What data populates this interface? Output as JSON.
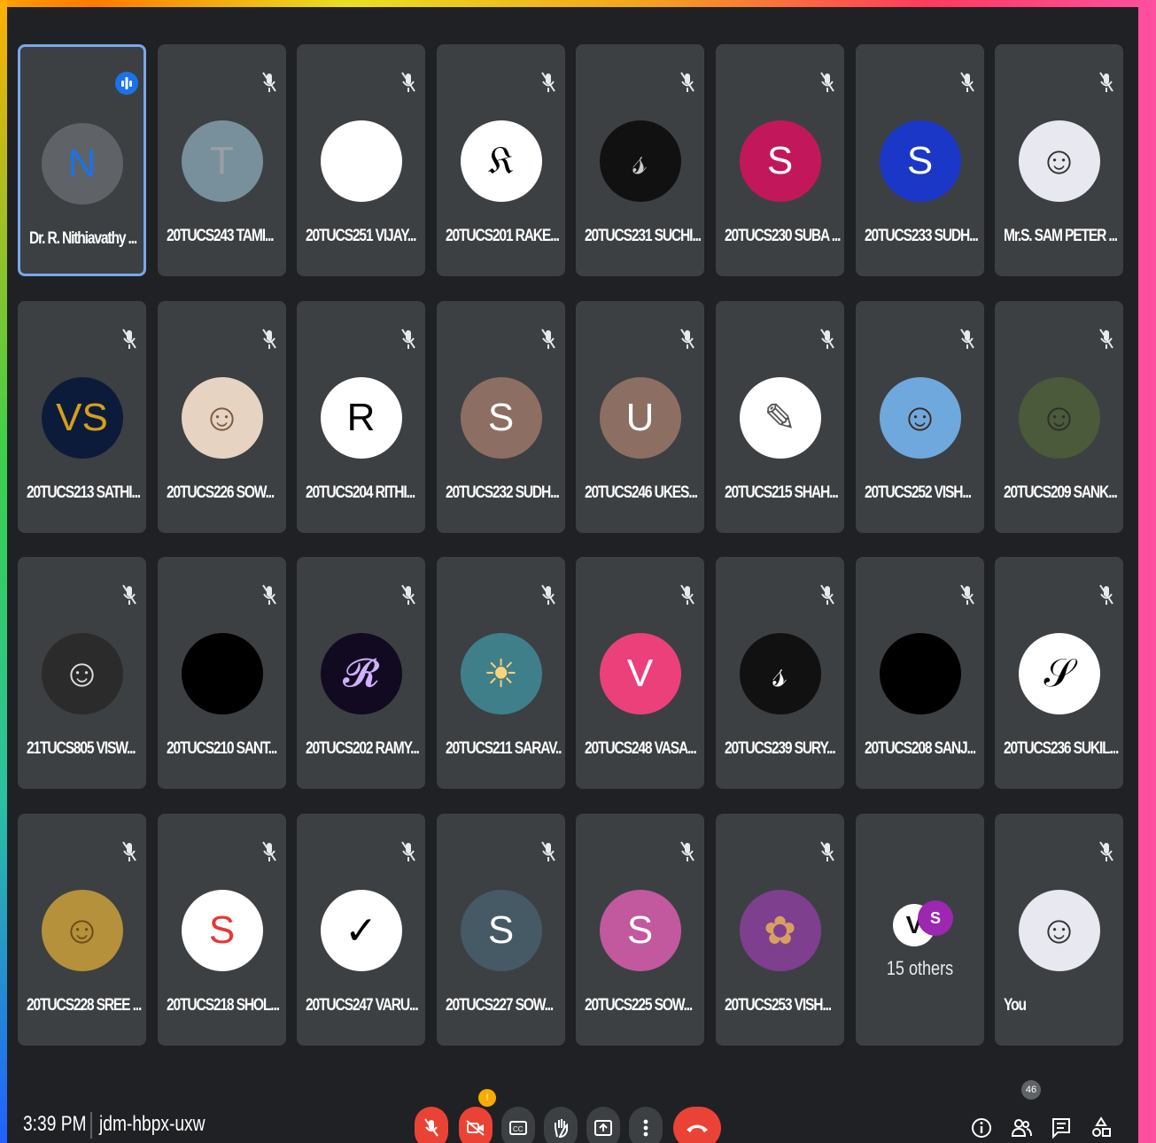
{
  "participants": [
    {
      "name": "Dr. R. Nithiavathy ...",
      "avatar_letter": "N",
      "avatar_color": "#1a73e8",
      "avatar_bg": "#5f6368",
      "speaking": true
    },
    {
      "name": "20TUCS243 TAMI...",
      "avatar_letter": "T",
      "avatar_color": "#9aa0a6",
      "avatar_bg": "#78909c"
    },
    {
      "name": "20TUCS251 VIJAY...",
      "avatar_letter": "",
      "avatar_color": "#ffffff",
      "avatar_bg": "#ffffff"
    },
    {
      "name": "20TUCS201 RAKE...",
      "avatar_letter": "𝔎",
      "avatar_color": "#000000",
      "avatar_bg": "#ffffff"
    },
    {
      "name": "20TUCS231 SUCHI...",
      "avatar_letter": "𝓈",
      "avatar_color": "#cccccc",
      "avatar_bg": "#111111"
    },
    {
      "name": "20TUCS230 SUBA ...",
      "avatar_letter": "S",
      "avatar_color": "#ffffff",
      "avatar_bg": "#c2185b"
    },
    {
      "name": "20TUCS233 SUDH...",
      "avatar_letter": "S",
      "avatar_color": "#ffffff",
      "avatar_bg": "#1a37c8"
    },
    {
      "name": "Mr.S. SAM PETER ...",
      "avatar_letter": "☺",
      "avatar_color": "#333333",
      "avatar_bg": "#e8e8f0"
    },
    {
      "name": "20TUCS213 SATHI...",
      "avatar_letter": "VS",
      "avatar_color": "#d4a017",
      "avatar_bg": "#0d1b3a"
    },
    {
      "name": "20TUCS226 SOW...",
      "avatar_letter": "☺",
      "avatar_color": "#7a5a40",
      "avatar_bg": "#e6d3c2"
    },
    {
      "name": "20TUCS204 RITHI...",
      "avatar_letter": "R",
      "avatar_color": "#000000",
      "avatar_bg": "#ffffff"
    },
    {
      "name": "20TUCS232 SUDH...",
      "avatar_letter": "S",
      "avatar_color": "#ffffff",
      "avatar_bg": "#8d6e63"
    },
    {
      "name": "20TUCS246 UKES...",
      "avatar_letter": "U",
      "avatar_color": "#ffffff",
      "avatar_bg": "#8d6e63"
    },
    {
      "name": "20TUCS215 SHAH...",
      "avatar_letter": "✎",
      "avatar_color": "#555555",
      "avatar_bg": "#ffffff"
    },
    {
      "name": "20TUCS252 VISH...",
      "avatar_letter": "☺",
      "avatar_color": "#3b2a20",
      "avatar_bg": "#6fa8dc"
    },
    {
      "name": "20TUCS209 SANK...",
      "avatar_letter": "☺",
      "avatar_color": "#2e2e2e",
      "avatar_bg": "#4a5a3a"
    },
    {
      "name": "21TUCS805 VISW...",
      "avatar_letter": "☺",
      "avatar_color": "#dddddd",
      "avatar_bg": "#2b2b2b"
    },
    {
      "name": "20TUCS210 SANT...",
      "avatar_letter": "",
      "avatar_color": "#000000",
      "avatar_bg": "#000000"
    },
    {
      "name": "20TUCS202 RAMY...",
      "avatar_letter": "𝓡",
      "avatar_color": "#d0b0ff",
      "avatar_bg": "#120a20"
    },
    {
      "name": "20TUCS211 SARAV...",
      "avatar_letter": "☀",
      "avatar_color": "#ffd27a",
      "avatar_bg": "#3f7f8a"
    },
    {
      "name": "20TUCS248 VASA...",
      "avatar_letter": "V",
      "avatar_color": "#ffffff",
      "avatar_bg": "#ec407a"
    },
    {
      "name": "20TUCS239 SURY...",
      "avatar_letter": "𝓈",
      "avatar_color": "#ffffff",
      "avatar_bg": "#111111"
    },
    {
      "name": "20TUCS208 SANJ...",
      "avatar_letter": "",
      "avatar_color": "#000000",
      "avatar_bg": "#000000"
    },
    {
      "name": "20TUCS236 SUKIL...",
      "avatar_letter": "𝒮",
      "avatar_color": "#000000",
      "avatar_bg": "#ffffff"
    },
    {
      "name": "20TUCS228 SREE ...",
      "avatar_letter": "☺",
      "avatar_color": "#6b4a1a",
      "avatar_bg": "#b4913a"
    },
    {
      "name": "20TUCS218 SHOL...",
      "avatar_letter": "S",
      "avatar_color": "#e53935",
      "avatar_bg": "#ffffff"
    },
    {
      "name": "20TUCS247 VARU...",
      "avatar_letter": "✓",
      "avatar_color": "#000000",
      "avatar_bg": "#ffffff"
    },
    {
      "name": "20TUCS227 SOW...",
      "avatar_letter": "S",
      "avatar_color": "#ffffff",
      "avatar_bg": "#455a64"
    },
    {
      "name": "20TUCS225 SOW...",
      "avatar_letter": "S",
      "avatar_color": "#ffffff",
      "avatar_bg": "#c2589e"
    },
    {
      "name": "20TUCS253 VISH...",
      "avatar_letter": "✿",
      "avatar_color": "#d8a060",
      "avatar_bg": "#7e3f8f"
    }
  ],
  "others_tile": {
    "label": "15 others",
    "avatar1_letter": "V",
    "avatar2_letter": "S",
    "avatar1_color": "#111111",
    "avatar2_color": "#9c27b0"
  },
  "self_tile": {
    "label": "You",
    "avatar_letter": "☺"
  },
  "bottom_bar": {
    "time": "3:39 PM",
    "meeting_code": "jdm-hbpx-uxw",
    "people_count": "46",
    "camera_alert": "!"
  },
  "colors": {
    "danger": "#ea4335",
    "panel": "#3c4043",
    "button": "#3c4043",
    "accent": "#1a73e8"
  }
}
